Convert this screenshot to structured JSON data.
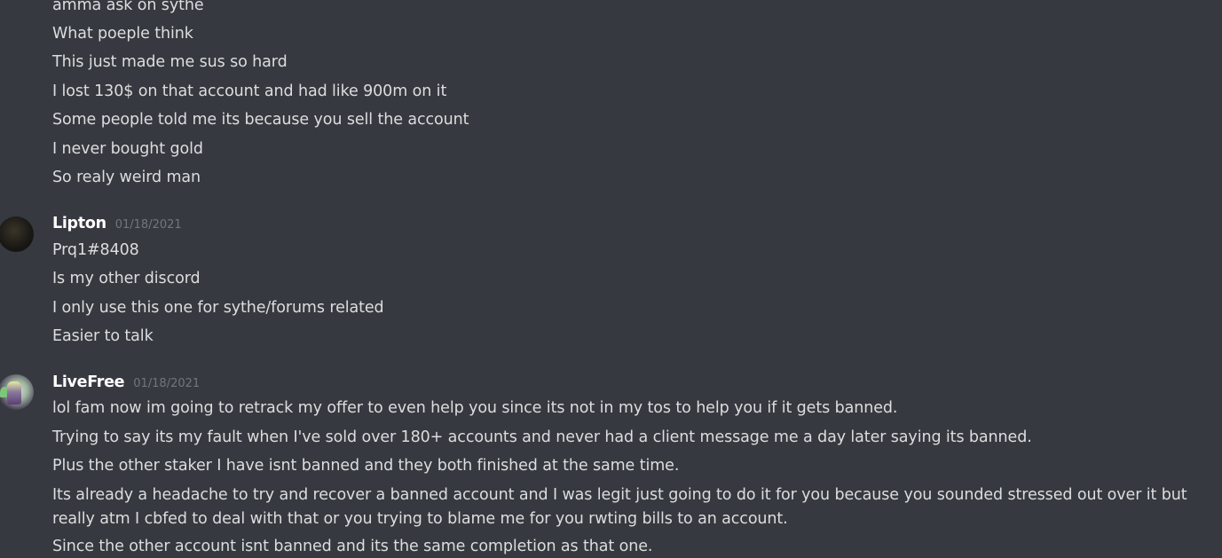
{
  "messages_top": [
    "amma ask on sythe",
    "What poeple think",
    "This just made me sus so hard",
    "I lost 130$ on that account and had like 900m on it",
    "Some people told me its because you sell the account",
    "I never bought gold",
    "So realy weird man"
  ],
  "lipton": {
    "username": "Lipton",
    "timestamp": "01/18/2021",
    "avatar_icon": "avatar-dark-icon",
    "lines": [
      "Prq1#8408",
      "Is my other discord",
      "I only use this one for sythe/forums related",
      "Easier to talk"
    ]
  },
  "livefree": {
    "username": "LiveFree",
    "timestamp": "01/18/2021",
    "avatar_icon": "avatar-character-icon",
    "lines": [
      "lol fam now im going to retrack my offer to even help you since its not in my tos to help you if it gets banned.",
      "Trying to say its my fault when I've sold over 180+ accounts and never had a client message me a day later saying its banned.",
      "Plus the other staker I have isnt banned and they both finished at the same time.",
      "Its already a headache to try and recover a banned account and I was legit just going to do it for you because you sounded stressed out over it but really atm I cbfed to deal with that or you trying to blame me for you rwting bills to an account.",
      "Since the other account isnt banned and its the same completion as that one."
    ]
  },
  "colors": {
    "background": "#36393f",
    "text": "#dcddde",
    "username": "#ffffff",
    "timestamp": "#72767d"
  }
}
